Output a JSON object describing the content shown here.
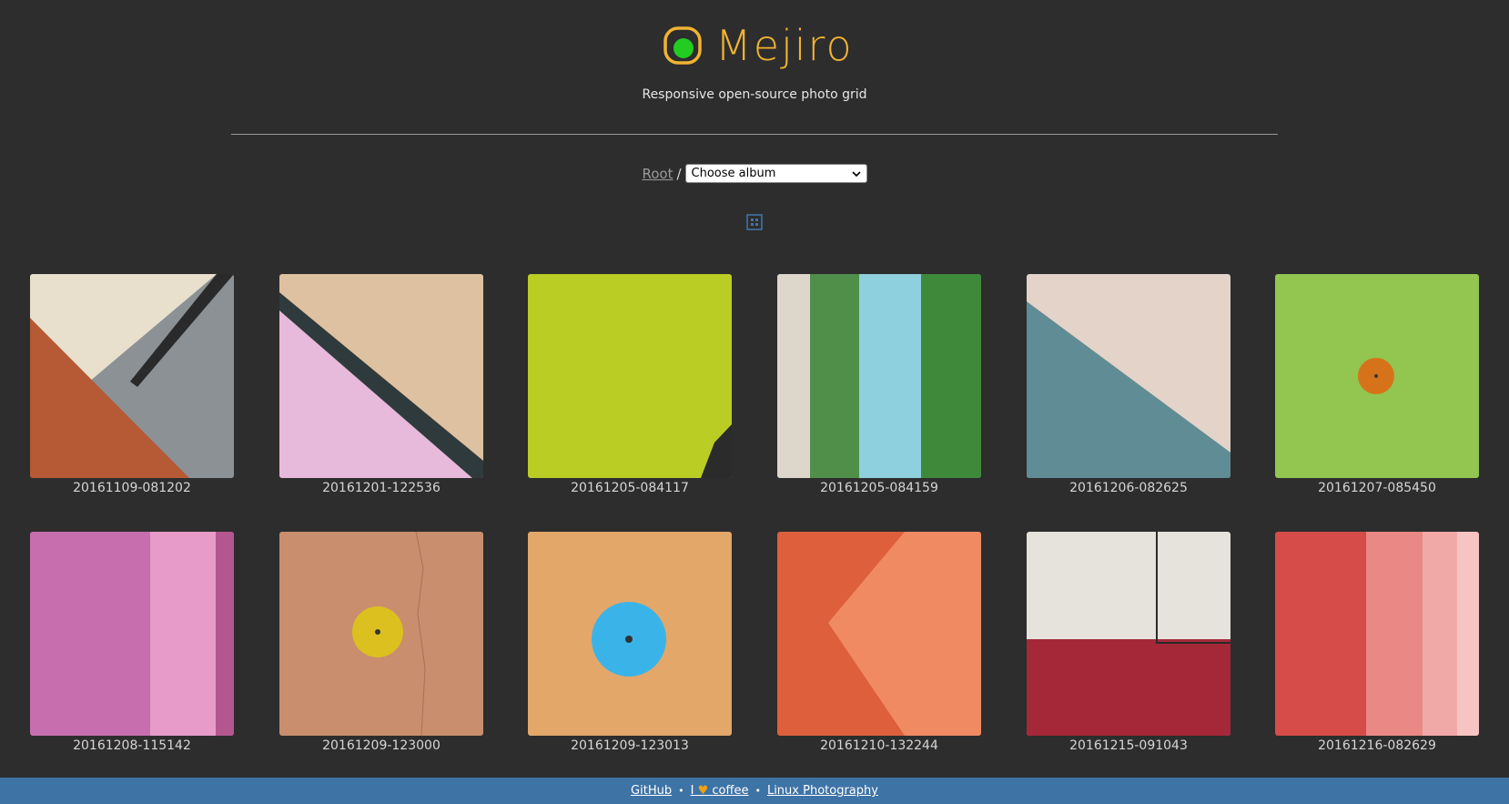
{
  "brand": {
    "name": "Mejiro",
    "tagline": "Responsive open-source photo grid",
    "accent_color": "#f0b333",
    "logo_dot_color": "#22cc22"
  },
  "breadcrumb": {
    "root_label": "Root",
    "separator": "/",
    "album_select_value": "Choose album"
  },
  "grid_toggle_icon": "grid-icon",
  "photos": [
    {
      "caption": "20161109-081202"
    },
    {
      "caption": "20161201-122536"
    },
    {
      "caption": "20161205-084117"
    },
    {
      "caption": "20161205-084159"
    },
    {
      "caption": "20161206-082625"
    },
    {
      "caption": "20161207-085450"
    },
    {
      "caption": "20161208-115142"
    },
    {
      "caption": "20161209-123000"
    },
    {
      "caption": "20161209-123013"
    },
    {
      "caption": "20161210-132244"
    },
    {
      "caption": "20161215-091043"
    },
    {
      "caption": "20161216-082629"
    }
  ],
  "footer": {
    "github_label": "GitHub",
    "coffee_prefix": "I",
    "coffee_label": "coffee",
    "photography_label": "Linux Photography",
    "bar_color": "#3e73a6"
  }
}
